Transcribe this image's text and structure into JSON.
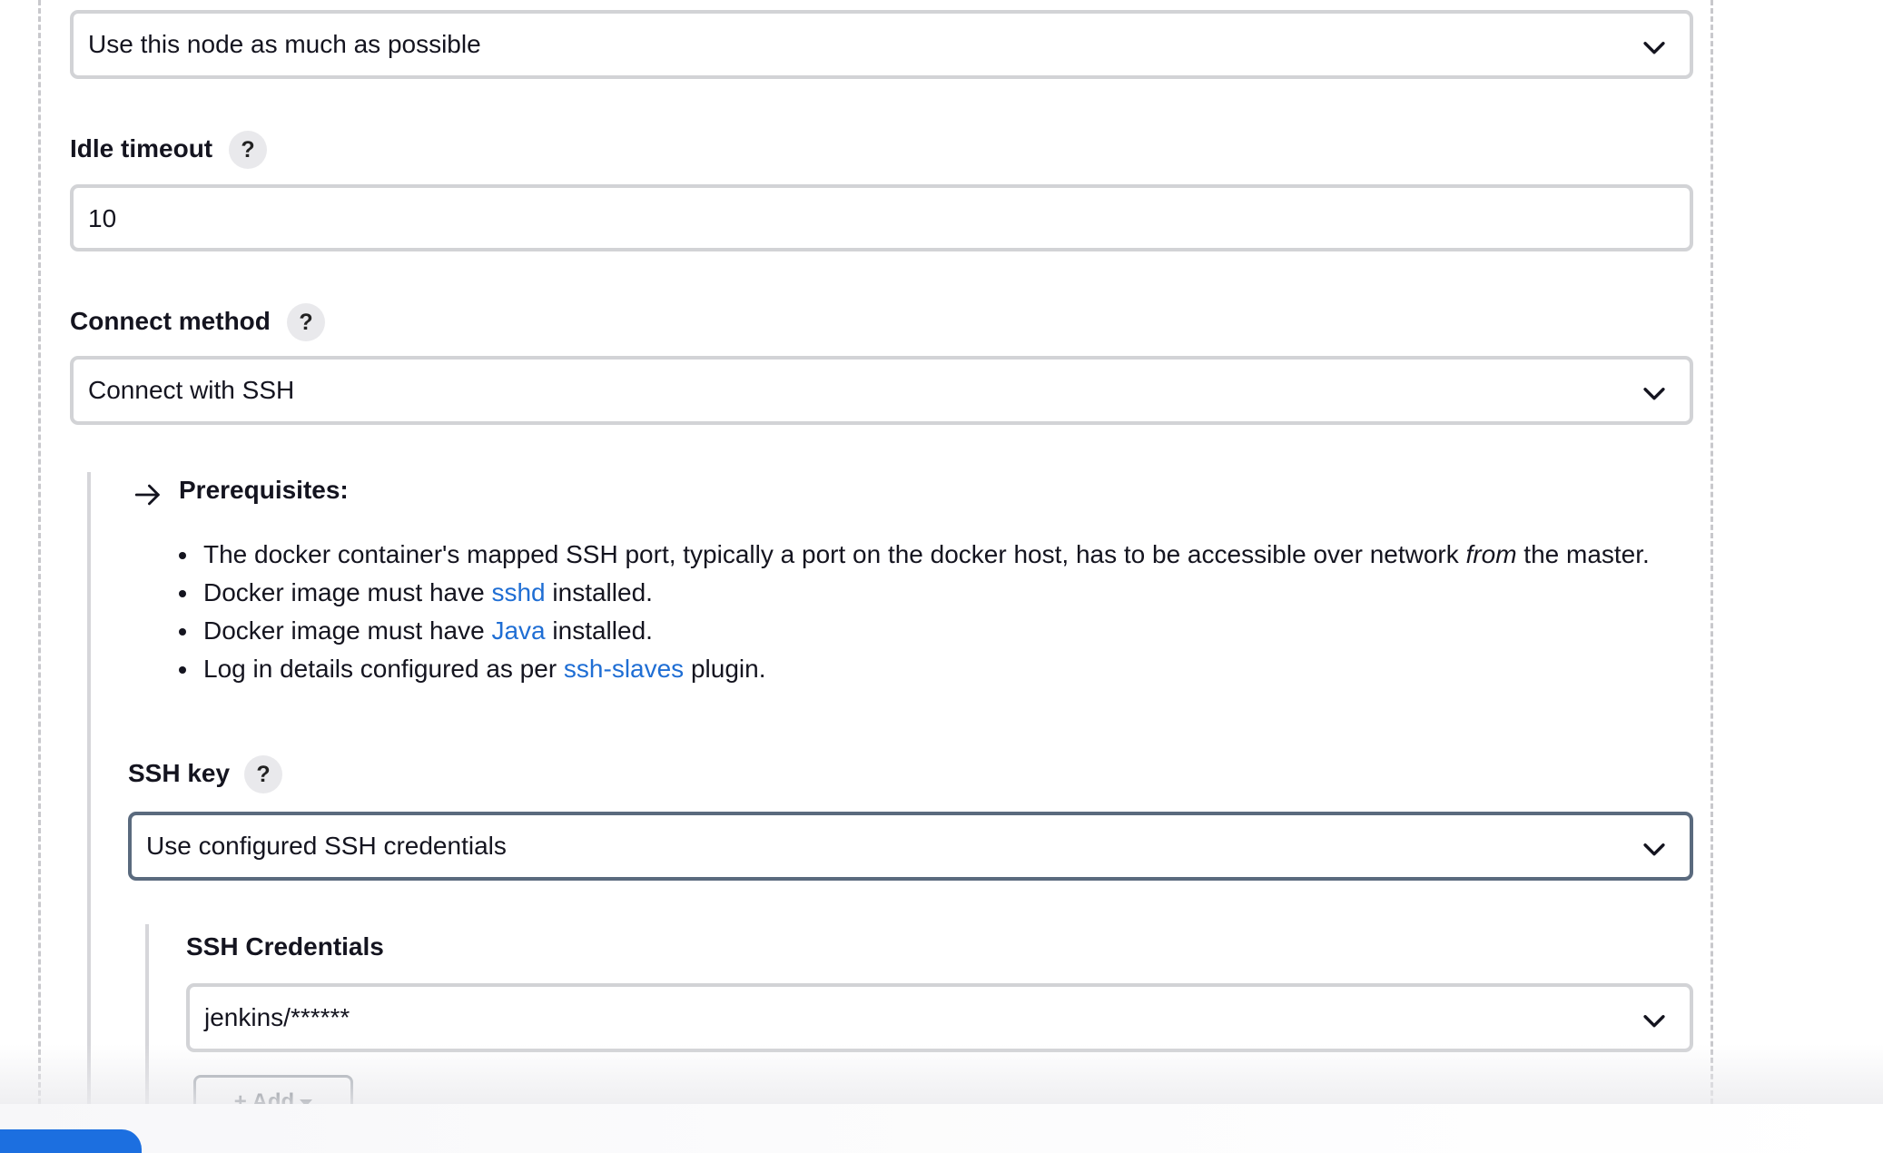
{
  "retention": {
    "selected": "Use this node as much as possible"
  },
  "idle_timeout": {
    "label": "Idle timeout",
    "help": "?",
    "value": "10"
  },
  "connect_method": {
    "label": "Connect method",
    "help": "?",
    "selected": "Connect with SSH"
  },
  "prerequisites": {
    "title": "Prerequisites:",
    "items": [
      {
        "before": "The docker container's mapped SSH port, typically a port on the docker host, has to be accessible over network ",
        "emphasis": "from",
        "after": " the master."
      },
      {
        "before": "Docker image must have ",
        "link": "sshd",
        "after": " installed."
      },
      {
        "before": "Docker image must have ",
        "link": "Java",
        "after": " installed."
      },
      {
        "before": "Log in details configured as per ",
        "link": "ssh-slaves",
        "after": " plugin."
      }
    ]
  },
  "ssh_key": {
    "label": "SSH key",
    "help": "?",
    "selected": "Use configured SSH credentials"
  },
  "ssh_credentials": {
    "label": "SSH Credentials",
    "selected": "jenkins/******",
    "add_label": "+ Add"
  },
  "colors": {
    "link": "#1f6ed4",
    "border": "#d2d3d6",
    "focused_border": "#5a6a7e",
    "primary": "#1c6fe0"
  }
}
